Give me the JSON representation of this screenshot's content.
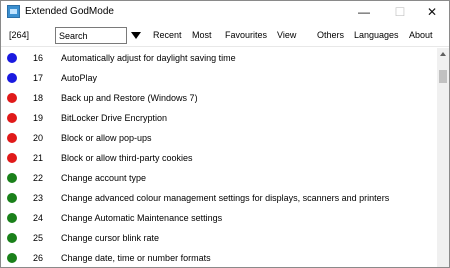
{
  "window": {
    "title": "Extended GodMode",
    "minimize": "—",
    "maximize": "☐",
    "close": "✕"
  },
  "toolbar": {
    "count": "[264]",
    "search_value": "Search",
    "menu": [
      "Recent",
      "Most",
      "Favourites",
      "View",
      "Others",
      "Languages",
      "About"
    ]
  },
  "colors": {
    "blue": "#1a1ae0",
    "red": "#e01a1a",
    "green": "#1a801a"
  },
  "items": [
    {
      "num": "16",
      "name": "Automatically adjust for daylight saving time",
      "color": "blue"
    },
    {
      "num": "17",
      "name": "AutoPlay",
      "color": "blue"
    },
    {
      "num": "18",
      "name": "Back up and Restore (Windows 7)",
      "color": "red"
    },
    {
      "num": "19",
      "name": "BitLocker Drive Encryption",
      "color": "red"
    },
    {
      "num": "20",
      "name": "Block or allow pop-ups",
      "color": "red"
    },
    {
      "num": "21",
      "name": "Block or allow third-party cookies",
      "color": "red"
    },
    {
      "num": "22",
      "name": "Change account type",
      "color": "green"
    },
    {
      "num": "23",
      "name": "Change advanced colour management settings for displays, scanners and printers",
      "color": "green"
    },
    {
      "num": "24",
      "name": "Change Automatic Maintenance settings",
      "color": "green"
    },
    {
      "num": "25",
      "name": "Change cursor blink rate",
      "color": "green"
    },
    {
      "num": "26",
      "name": "Change date, time or number formats",
      "color": "green"
    }
  ]
}
